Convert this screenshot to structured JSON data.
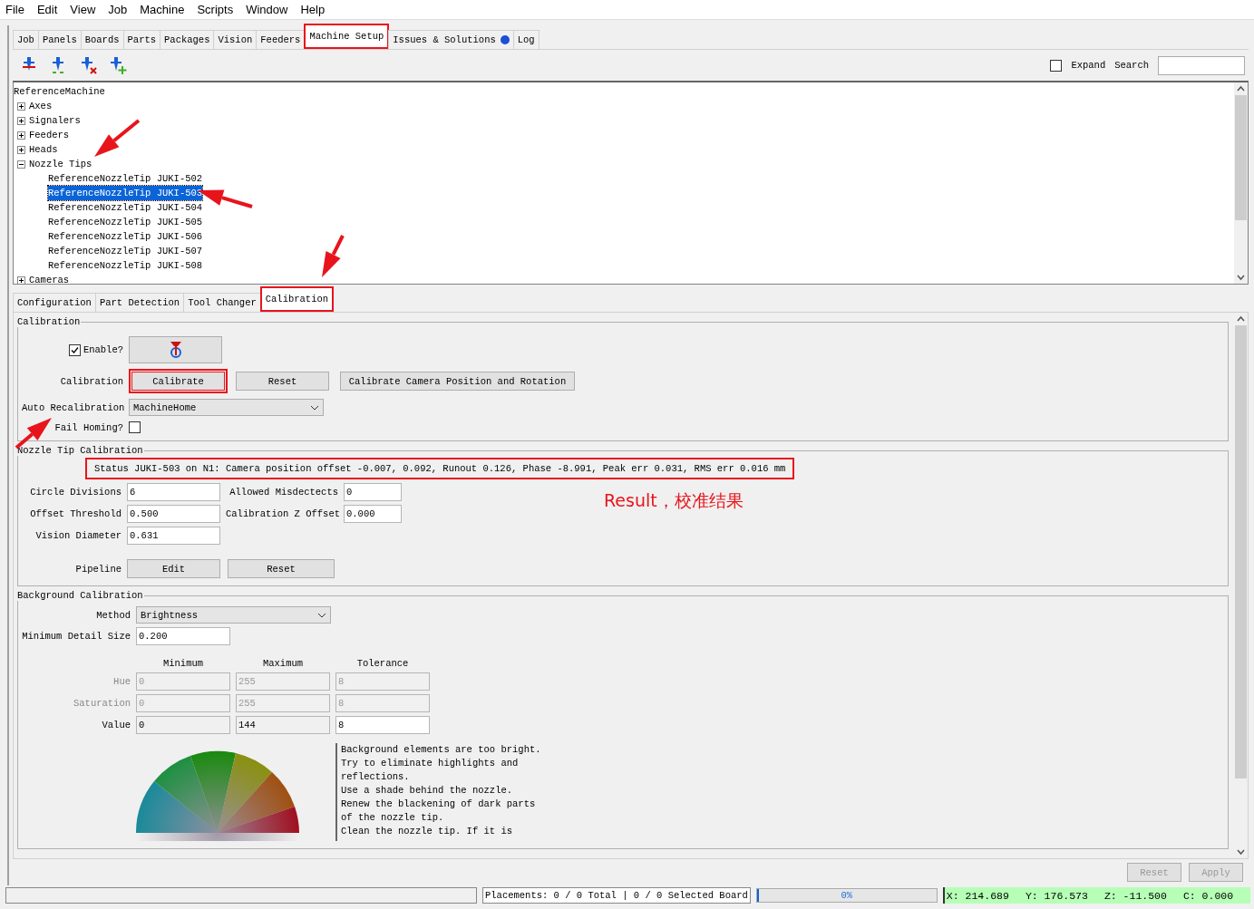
{
  "menu": [
    "File",
    "Edit",
    "View",
    "Job",
    "Machine",
    "Scripts",
    "Window",
    "Help"
  ],
  "tabs": [
    {
      "label": "Job",
      "selected": false
    },
    {
      "label": "Panels",
      "selected": false
    },
    {
      "label": "Boards",
      "selected": false
    },
    {
      "label": "Parts",
      "selected": false
    },
    {
      "label": "Packages",
      "selected": false
    },
    {
      "label": "Vision",
      "selected": false
    },
    {
      "label": "Feeders",
      "selected": false
    },
    {
      "label": "Machine Setup",
      "selected": true,
      "highlighted": true
    },
    {
      "label": "Issues & Solutions",
      "selected": false,
      "indicator": true
    },
    {
      "label": "Log",
      "selected": false
    }
  ],
  "expand": {
    "label": "Expand",
    "checked": false
  },
  "search": {
    "label": "Search"
  },
  "tree": {
    "root": "ReferenceMachine",
    "children": [
      {
        "label": "Axes",
        "expanded": false
      },
      {
        "label": "Signalers",
        "expanded": false
      },
      {
        "label": "Feeders",
        "expanded": false
      },
      {
        "label": "Heads",
        "expanded": false
      },
      {
        "label": "Nozzle Tips",
        "expanded": true,
        "children": [
          {
            "label": "ReferenceNozzleTip JUKI-502",
            "selected": false
          },
          {
            "label": "ReferenceNozzleTip JUKI-503",
            "selected": true
          },
          {
            "label": "ReferenceNozzleTip JUKI-504",
            "selected": false
          },
          {
            "label": "ReferenceNozzleTip JUKI-505",
            "selected": false
          },
          {
            "label": "ReferenceNozzleTip JUKI-506",
            "selected": false
          },
          {
            "label": "ReferenceNozzleTip JUKI-507",
            "selected": false
          },
          {
            "label": "ReferenceNozzleTip JUKI-508",
            "selected": false
          }
        ]
      },
      {
        "label": "Cameras",
        "expanded": false
      }
    ]
  },
  "subtabs": [
    {
      "label": "Configuration",
      "selected": false
    },
    {
      "label": "Part Detection",
      "selected": false
    },
    {
      "label": "Tool Changer",
      "selected": false
    },
    {
      "label": "Calibration",
      "selected": true,
      "highlighted": true
    }
  ],
  "calibration": {
    "title": "Calibration",
    "enable": {
      "label": "Enable?",
      "checked": true
    },
    "calibration_label": "Calibration",
    "buttons": [
      {
        "label": "Calibrate",
        "highlighted": true
      },
      {
        "label": "Reset",
        "highlighted": false
      },
      {
        "label": "Calibrate Camera Position and Rotation",
        "highlighted": false
      }
    ],
    "auto_recalibration": {
      "label": "Auto Recalibration",
      "value": "MachineHome"
    },
    "fail_homing": {
      "label": "Fail Homing?",
      "checked": false
    }
  },
  "nozzle_tip_calibration": {
    "title": "Nozzle Tip Calibration",
    "status": "Status JUKI-503 on N1: Camera position offset -0.007, 0.092, Runout 0.126, Phase -8.991, Peak err 0.031, RMS err 0.016 mm",
    "status_highlighted": true,
    "fields": [
      {
        "label": "Circle Divisions",
        "value": "6"
      },
      {
        "label": "Allowed Misdectects",
        "value": "0"
      },
      {
        "label": "Offset Threshold",
        "value": "0.500"
      },
      {
        "label": "Calibration Z Offset",
        "value": "0.000"
      },
      {
        "label": "Vision Diameter",
        "value": "0.631"
      }
    ],
    "pipeline": {
      "label": "Pipeline",
      "buttons": [
        "Edit",
        "Reset"
      ]
    }
  },
  "annotation": "Result，校准结果",
  "background_calibration": {
    "title": "Background Calibration",
    "method": {
      "label": "Method",
      "value": "Brightness"
    },
    "min_detail": {
      "label": "Minimum Detail Size",
      "value": "0.200"
    },
    "columns": [
      "Minimum",
      "Maximum",
      "Tolerance"
    ],
    "rows": [
      {
        "label": "Hue",
        "disabled": true,
        "cells": [
          {
            "value": "0",
            "editable": false
          },
          {
            "value": "255",
            "editable": false
          },
          {
            "value": "8",
            "editable": false
          }
        ]
      },
      {
        "label": "Saturation",
        "disabled": true,
        "cells": [
          {
            "value": "0",
            "editable": false
          },
          {
            "value": "255",
            "editable": false
          },
          {
            "value": "8",
            "editable": false
          }
        ]
      },
      {
        "label": "Value",
        "disabled": false,
        "cells": [
          {
            "value": "0",
            "editable": false
          },
          {
            "value": "144",
            "editable": false
          },
          {
            "value": "8",
            "editable": true
          }
        ]
      }
    ],
    "hint": [
      "Background elements are too bright.",
      "Try to eliminate highlights and",
      "reflections.",
      "Use a shade behind the nozzle.",
      "Renew the blackening of dark parts",
      "of the nozzle tip.",
      "Clean the nozzle tip. If it is"
    ]
  },
  "footer_buttons": [
    {
      "label": "Reset",
      "disabled": true
    },
    {
      "label": "Apply",
      "disabled": true
    }
  ],
  "status_bar": {
    "placements": "Placements: 0 / 0 Total | 0 / 0 Selected Board",
    "progress": {
      "label": "0%",
      "level": 0
    },
    "coords": [
      "X: 214.689",
      "Y: 176.573",
      "Z: -11.500",
      "C: 0.000"
    ]
  }
}
